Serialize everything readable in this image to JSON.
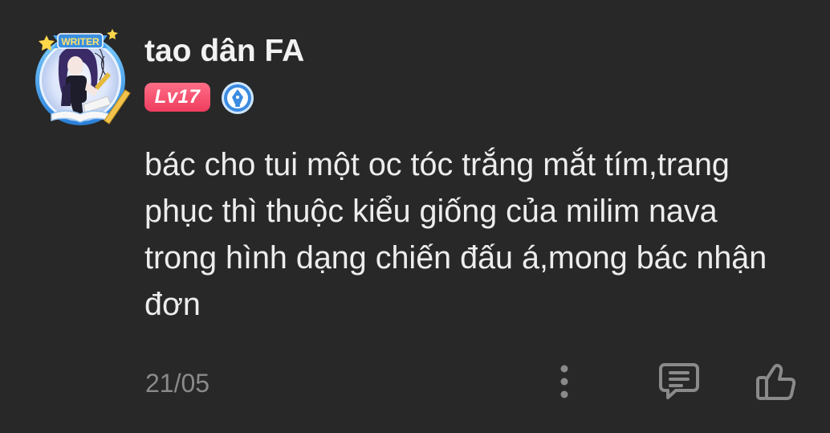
{
  "comment": {
    "username": "tao dân FA",
    "level": "Lv17",
    "avatar_frame_label": "WRITER",
    "body_lines": [
      "bác cho tui một oc tóc trắng mắt tím,trang",
      "phục thì thuộc kiểu giống của milim nava",
      "trong hình dạng chiến đấu á,mong bác nhận",
      "đơn"
    ],
    "date": "21/05"
  },
  "icons": {
    "writer_badge": "fountain-pen-badge-icon",
    "more": "more-vertical-icon",
    "reply": "comment-icon",
    "like": "thumbs-up-icon"
  },
  "colors": {
    "background": "#282828",
    "level_badge": "#f04663",
    "writer_badge": "#3b8be0",
    "text": "#ededed",
    "muted": "#8a8a8a"
  }
}
